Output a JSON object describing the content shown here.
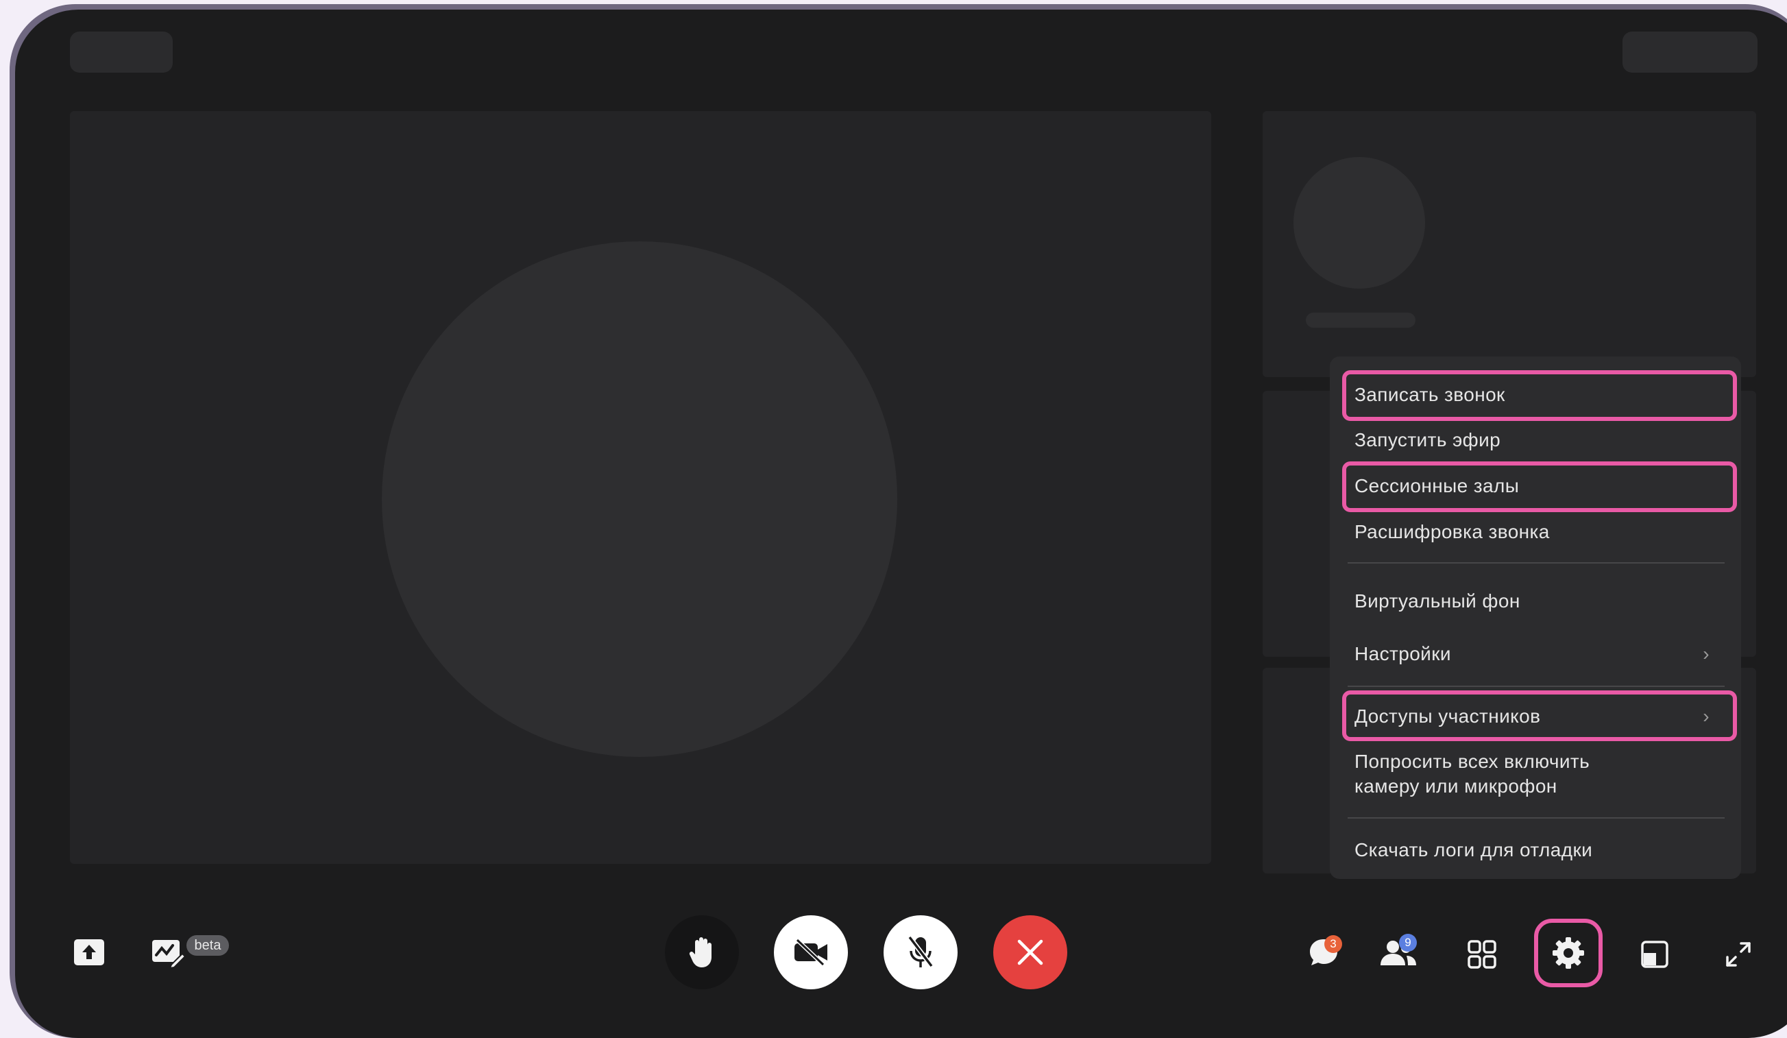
{
  "menu": {
    "items": [
      {
        "label": "Записать звонок"
      },
      {
        "label": "Запустить эфир"
      },
      {
        "label": "Сессионные залы"
      },
      {
        "label": "Расшифровка звонка"
      },
      {
        "label": "Виртуальный фон"
      },
      {
        "label": "Настройки",
        "chevron": "›"
      },
      {
        "label": "Доступы участников",
        "chevron": "›"
      },
      {
        "label_line1": "Попросить всех включить",
        "label_line2": "камеру или микрофон"
      },
      {
        "label": "Скачать логи для отладки"
      }
    ]
  },
  "toolbar": {
    "left": [
      {
        "icon": "share-screen-icon"
      },
      {
        "icon": "whiteboard-icon",
        "badge": "beta"
      }
    ],
    "center": [
      {
        "icon": "raise-hand-icon"
      },
      {
        "icon": "camera-off-icon"
      },
      {
        "icon": "mic-off-icon"
      },
      {
        "icon": "end-call-icon"
      }
    ],
    "right": [
      {
        "icon": "chat-icon",
        "badge": "3"
      },
      {
        "icon": "participants-icon",
        "badge": "9"
      },
      {
        "icon": "grid-icon"
      },
      {
        "icon": "settings-icon"
      },
      {
        "icon": "layout-icon"
      },
      {
        "icon": "fullscreen-icon"
      }
    ]
  },
  "colors": {
    "highlight": "#e95aa6",
    "end_call": "#e5413f",
    "chat_badge": "#e8623a",
    "participants_badge": "#5b7fe0",
    "background": "#1c1c1d"
  }
}
